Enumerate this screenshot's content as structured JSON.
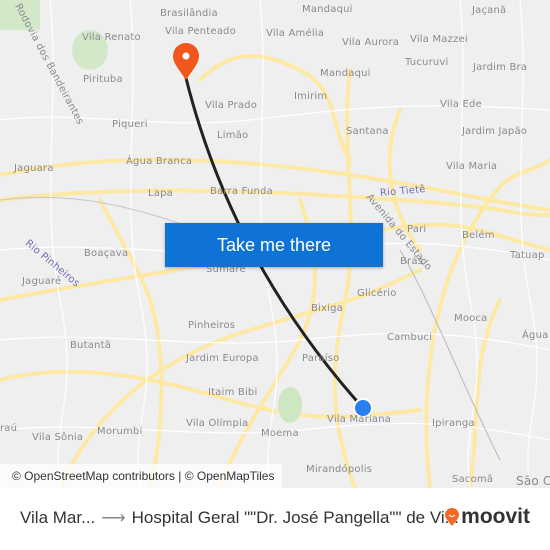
{
  "map": {
    "labels": [
      "Brasilândia",
      "Mandaqui",
      "Jaçanã",
      "Vila Renato",
      "Vila Penteado",
      "Vila Amélia",
      "Vila Aurora",
      "Vila Mazzei",
      "Tucuruvi",
      "Jardim Bra",
      "Pirituba",
      "Mandaqui",
      "Imirim",
      "Vila Prado",
      "Vila Ede",
      "Piqueri",
      "Limão",
      "Santana",
      "Jardim Japão",
      "Água Branca",
      "Jaguara",
      "Vila Maria",
      "Lapa",
      "Barra Funda",
      "Pari",
      "Belém",
      "Boaçava",
      "Brás",
      "Tatuap",
      "Jaguaré",
      "Sumaré",
      "Glicério",
      "Bixiga",
      "Mooca",
      "Pinheiros",
      "Cambuci",
      "Butantã",
      "Água",
      "Jardim Europa",
      "Paraíso",
      "Itaim Bibi",
      "Vila Mariana",
      "Ipiranga",
      "raú",
      "Vila Sônia",
      "Morumbi",
      "Vila Olímpia",
      "Moema",
      "Mirandópolis",
      "Sacomã",
      "São C"
    ],
    "water_labels": [
      "Rodovia dos Bandeirantes",
      "Rio Tietê",
      "Avenida do Estado",
      "Rio Pinheiros"
    ],
    "origin_color": "#2a7ff0",
    "destination_color": "#f0561d",
    "route_color": "#222222",
    "road_color": "#fde9a4"
  },
  "cta_label": "Take me there",
  "attribution": "© OpenStreetMap contributors | © OpenMapTiles",
  "footer": {
    "origin": "Vila Mar...",
    "destination": "Hospital Geral \"\"Dr. José Pangella\"\" de Vi...",
    "logo_text": "moovit",
    "logo_color": "#f26a21"
  }
}
